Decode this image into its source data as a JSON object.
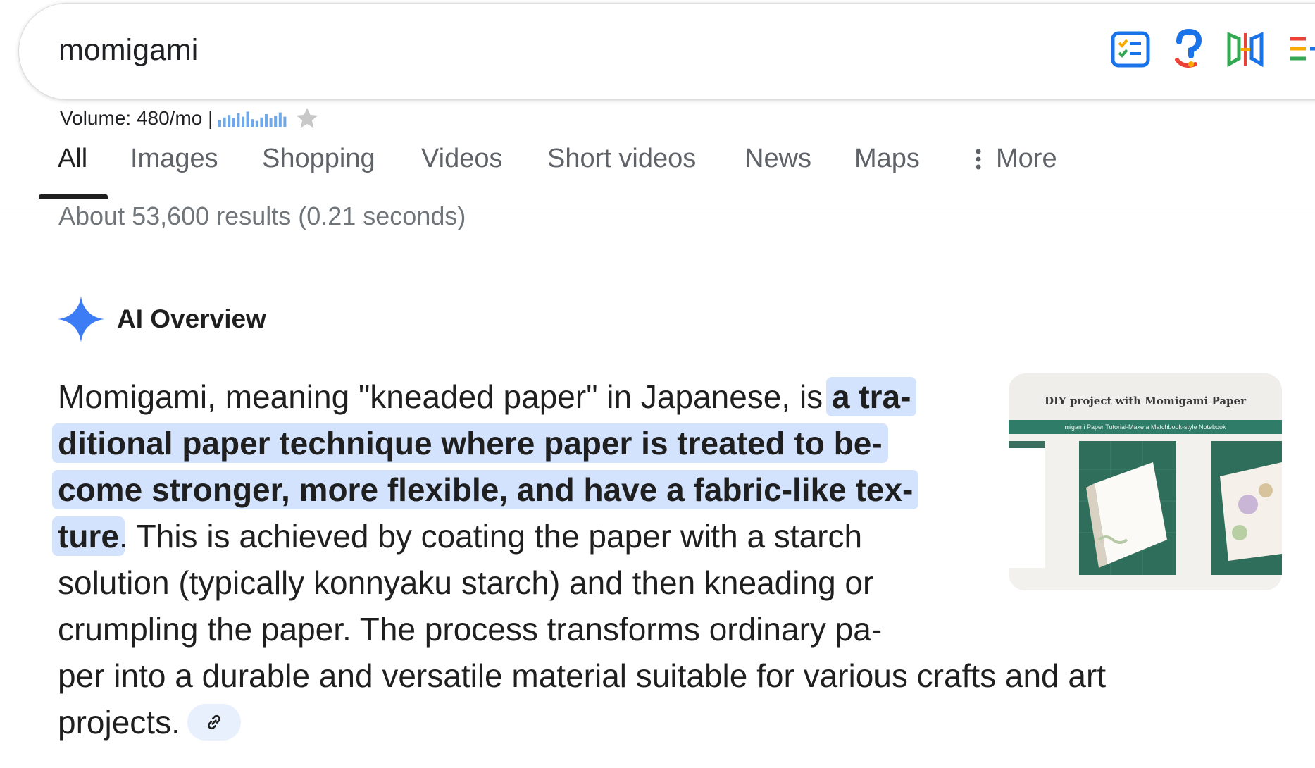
{
  "search": {
    "query": "momigami",
    "extensions": [
      "checklist-icon",
      "question-icon",
      "split-icon",
      "list-add-icon"
    ]
  },
  "volume": {
    "text": "Volume: 480/mo |",
    "trend": [
      0.4,
      0.55,
      0.7,
      0.5,
      0.8,
      0.6,
      0.9,
      0.45,
      0.35,
      0.55,
      0.75,
      0.5,
      0.65,
      0.85,
      0.6
    ],
    "star_icon": "star-icon"
  },
  "tabs": [
    {
      "label": "All",
      "active": true
    },
    {
      "label": "Images"
    },
    {
      "label": "Shopping"
    },
    {
      "label": "Videos"
    },
    {
      "label": "Short videos"
    },
    {
      "label": "News"
    },
    {
      "label": "Maps"
    },
    {
      "label": "More"
    }
  ],
  "result_stats": "About 53,600 results (0.21 seconds)",
  "ai_overview": {
    "title": "AI Overview",
    "accent_color": "#3c7cf5",
    "highlight_color": "#d3e3fd",
    "lines": [
      {
        "pre": "Momigami, meaning \"kneaded paper\" in Japanese, is ",
        "hl": "a tra-",
        "post": ""
      },
      {
        "pre": "",
        "hl": "ditional paper technique where paper is treated to be-",
        "post": ""
      },
      {
        "pre": "",
        "hl": "come stronger, more flexible, and have a fabric-like tex-",
        "post": ""
      },
      {
        "pre": "",
        "hl": "ture",
        "post": ". This is achieved by coating the paper with a starch"
      },
      {
        "pre": "solution (typically konnyaku starch) and then kneading or",
        "hl": "",
        "post": ""
      },
      {
        "pre": "crumpling the paper. The process transforms ordinary pa-",
        "hl": "",
        "post": ""
      },
      {
        "pre": "per into a durable and versatile material suitable for various crafts and art",
        "hl": "",
        "post": ""
      },
      {
        "pre": "projects.",
        "hl": "",
        "post": ""
      }
    ],
    "link_icon": "link-icon",
    "thumbnail": {
      "title": "DIY project with Momigami Paper",
      "subtitle": "migami Paper Tutorial-Make a Matchbook-style Notebook"
    }
  }
}
